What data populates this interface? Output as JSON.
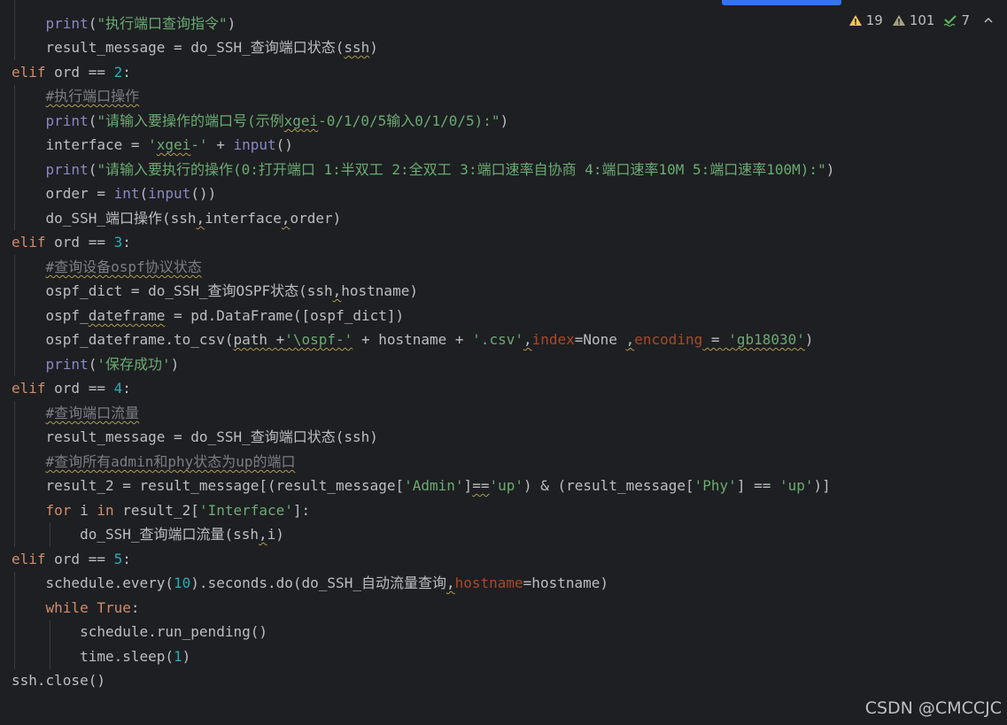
{
  "inspections": {
    "warnings": "19",
    "weak_warnings": "101",
    "typos": "7"
  },
  "watermark": "CSDN @CMCCJC",
  "colors": {
    "background": "#1e1f22",
    "keyword": "#cf8e6d",
    "string": "#6aab73",
    "number": "#2aacb8",
    "comment": "#7a7e85",
    "builtin": "#8888c6",
    "param": "#aa4926"
  },
  "code": {
    "l1": [
      "print",
      "(",
      "\"执行端口查询指令\"",
      ")"
    ],
    "l2": [
      "result_message = do_SSH_查询端口状态(",
      "ssh",
      ")"
    ],
    "l3": [
      "elif",
      " ord == ",
      "2",
      ":"
    ],
    "l4": [
      "#执行端口操作"
    ],
    "l5": [
      "print",
      "(",
      "\"请输入要操作的端口号(示例",
      "xgei",
      "-0/1/0/5输入0/1/0/5):\"",
      ")"
    ],
    "l6": [
      "interface = ",
      "'",
      "xgei",
      "-'",
      " + ",
      "input",
      "()"
    ],
    "l7": [
      "print",
      "(",
      "\"请输入要执行的操作(0:打开端口 1:半双工 2:全双工 3:端口速率自协商 4:端口速率10M 5:端口速率100M):\"",
      ")"
    ],
    "l8": [
      "order = ",
      "int",
      "(",
      "input",
      "())"
    ],
    "l9": [
      "do_SSH_端口操作(ssh",
      ",",
      "interface",
      ",",
      "order)"
    ],
    "l10": [
      "elif",
      " ord == ",
      "3",
      ":"
    ],
    "l11": [
      "#查询设备ospf协议状态"
    ],
    "l12": [
      "ospf_dict = do_SSH_查询OSPF状态(ssh",
      ",",
      "hostname)"
    ],
    "l13": [
      "ospf_",
      "dateframe",
      " = pd.DataFrame([ospf_dict])"
    ],
    "l14": [
      "ospf_dateframe.to_csv(",
      "path +",
      "'\\ospf-'",
      " + hostname + ",
      "'.csv'",
      ",",
      "index",
      "=None ",
      ",",
      "encoding",
      " = ",
      "'gb18030'",
      ")"
    ],
    "l15": [
      "print",
      "(",
      "'保存成功'",
      ")"
    ],
    "l16": [
      "elif",
      " ord == ",
      "4",
      ":"
    ],
    "l17": [
      "#查询端口流量"
    ],
    "l18": [
      "result_message = do_SSH_查询端口状态(ssh)"
    ],
    "l19": [
      "#查询所有admin和phy状态为up的端口"
    ],
    "l20": [
      "result_2 = result_message[(result_message[",
      "'Admin'",
      "]",
      "==",
      "'up'",
      ") & (result_message[",
      "'Phy'",
      "] == ",
      "'up'",
      ")]"
    ],
    "l21": [
      "for",
      " i ",
      "in",
      " result_2[",
      "'Interface'",
      "]:"
    ],
    "l22": [
      "do_SSH_查询端口流量(ssh",
      ",",
      "i)"
    ],
    "l23": [
      "elif",
      " ord == ",
      "5",
      ":"
    ],
    "l24": [
      "schedule.every(",
      "10",
      ").seconds.do(do_SSH_自动流量查询",
      ",",
      "hostname",
      "=hostname)"
    ],
    "l25": [
      "while",
      " ",
      "True",
      ":"
    ],
    "l26": [
      "schedule.run_pending()"
    ],
    "l27": [
      "time.sleep(",
      "1",
      ")"
    ],
    "l28": [
      "ssh.close()"
    ]
  }
}
